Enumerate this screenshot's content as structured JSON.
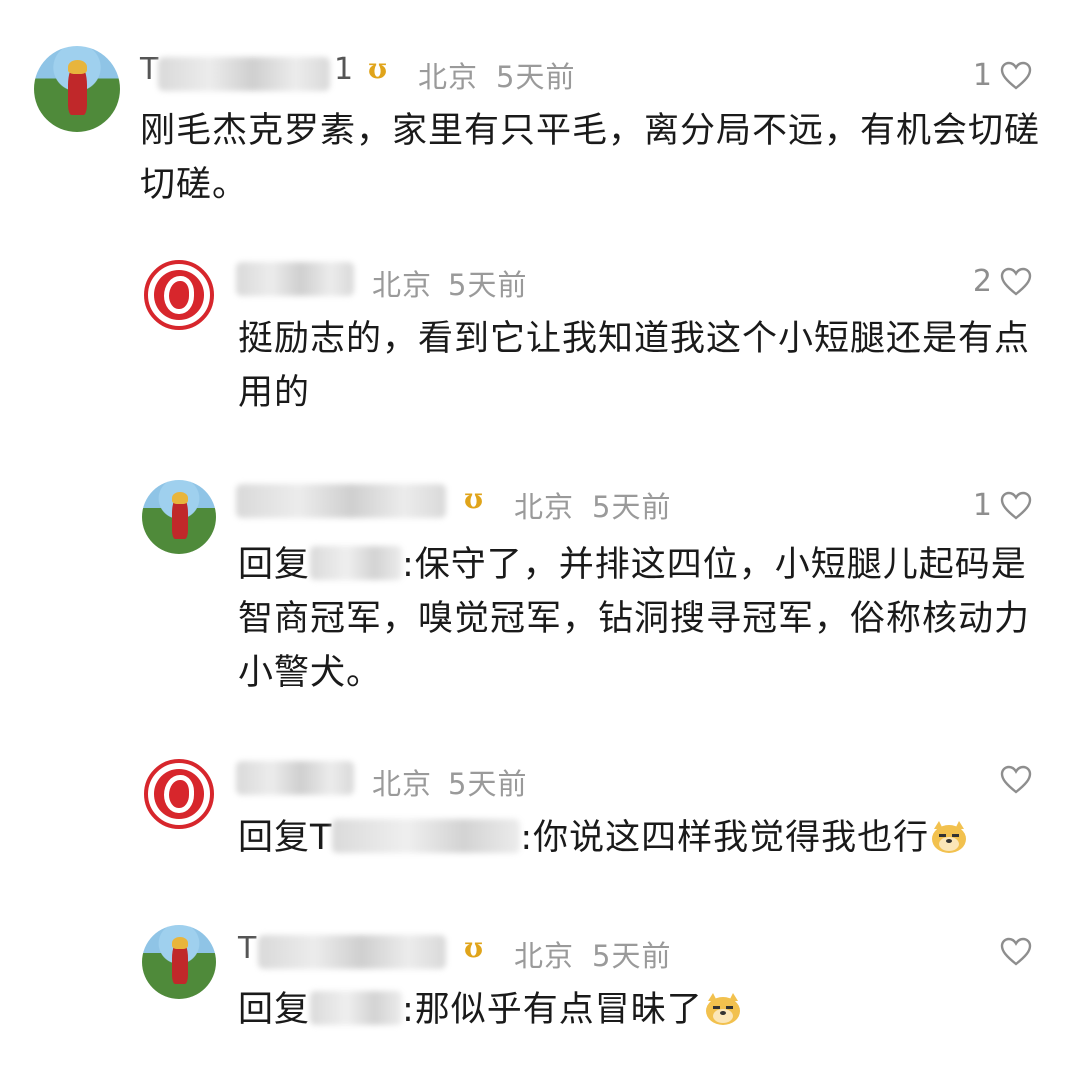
{
  "comments": [
    {
      "name_visible": "T",
      "name_tail": "1",
      "location": "北京",
      "time": "5天前",
      "likes": "1",
      "text": "刚毛杰克罗素，家里有只平毛，离分局不远，有机会切磋切磋。"
    },
    {
      "location": "北京",
      "time": "5天前",
      "likes": "2",
      "text": "挺励志的，看到它让我知道我这个小短腿还是有点用的"
    },
    {
      "location": "北京",
      "time": "5天前",
      "likes": "1",
      "reply_prefix": "回复",
      "text": ":保守了，并排这四位，小短腿儿起码是智商冠军，嗅觉冠军，钻洞搜寻冠军，俗称核动力小警犬。"
    },
    {
      "location": "北京",
      "time": "5天前",
      "reply_prefix": "回复T",
      "text": ":你说这四样我觉得我也行"
    },
    {
      "name_visible": "T",
      "location": "北京",
      "time": "5天前",
      "reply_prefix": "回复",
      "text": ":那似乎有点冒昧了"
    }
  ],
  "icons": {
    "vip_badge": "vip-badge-icon",
    "like": "heart-outline-icon",
    "emoji": "doge-emoji-icon"
  },
  "colors": {
    "badge": "#e0a41a",
    "meta": "#9a9a9a",
    "seal_red": "#d7262c"
  }
}
